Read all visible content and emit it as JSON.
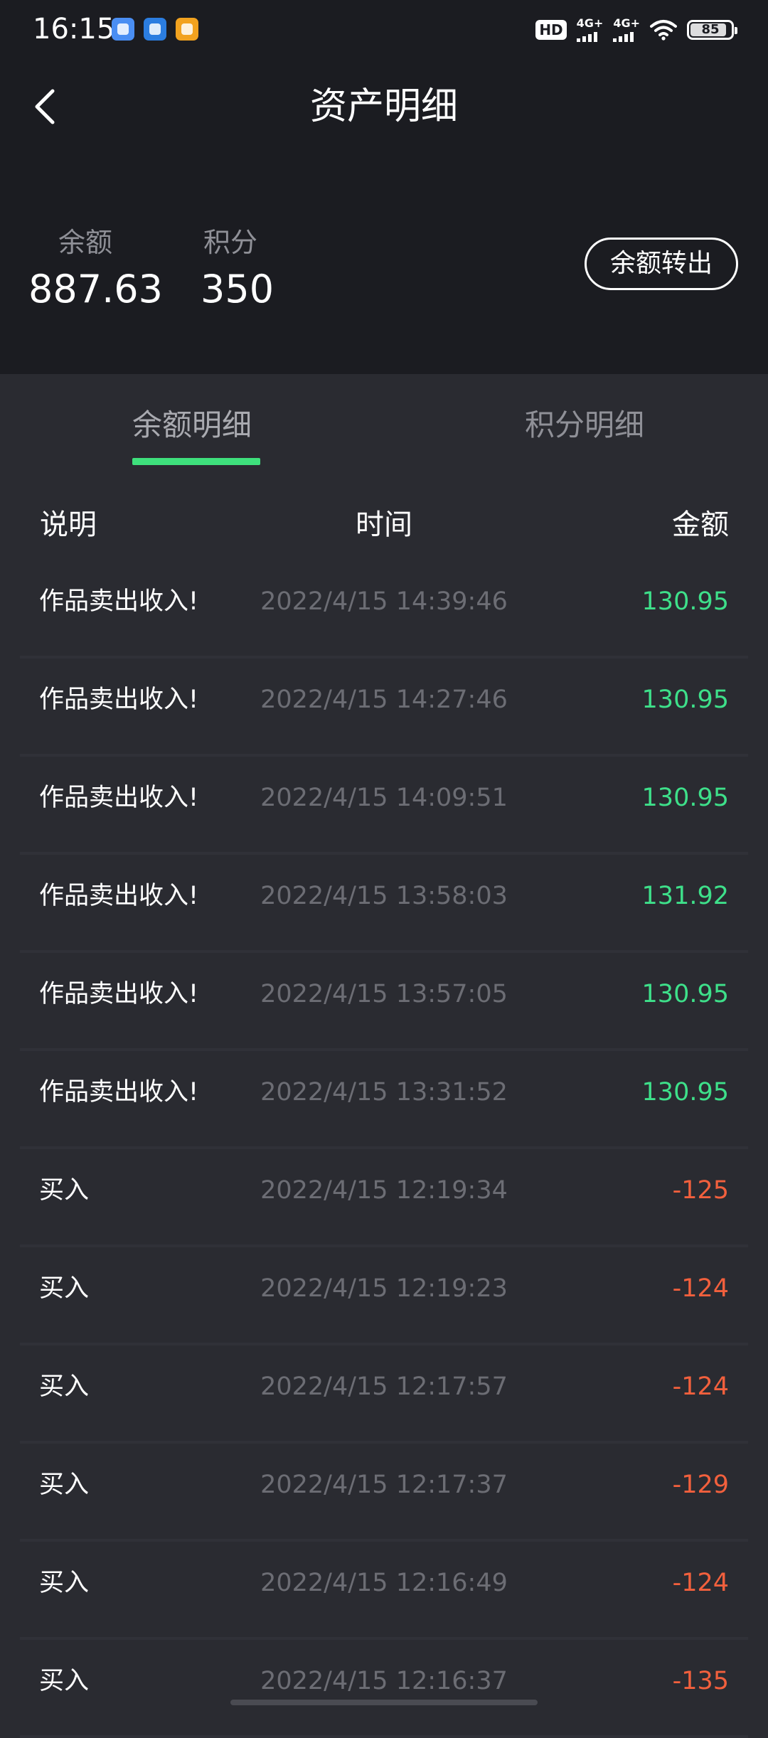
{
  "status_bar": {
    "time": "16:15",
    "hd_label": "HD",
    "network_1": "4G+",
    "network_2": "4G+",
    "battery": "85",
    "app_icons": [
      "baidu-icon",
      "tower-icon",
      "mail-icon"
    ]
  },
  "header": {
    "title": "资产明细",
    "back_icon": "chevron-left-icon"
  },
  "summary": {
    "balance_label": "余额",
    "balance_value": "887.63",
    "points_label": "积分",
    "points_value": "350",
    "transfer_button": "余额转出"
  },
  "tabs": [
    {
      "label": "余额明细",
      "active": true
    },
    {
      "label": "积分明细",
      "active": false
    }
  ],
  "table": {
    "columns": [
      "说明",
      "时间",
      "金额"
    ],
    "rows": [
      {
        "desc": "作品卖出收入!",
        "time": "2022/4/15 14:39:46",
        "amount": "130.95",
        "type": "income"
      },
      {
        "desc": "作品卖出收入!",
        "time": "2022/4/15 14:27:46",
        "amount": "130.95",
        "type": "income"
      },
      {
        "desc": "作品卖出收入!",
        "time": "2022/4/15 14:09:51",
        "amount": "130.95",
        "type": "income"
      },
      {
        "desc": "作品卖出收入!",
        "time": "2022/4/15 13:58:03",
        "amount": "131.92",
        "type": "income"
      },
      {
        "desc": "作品卖出收入!",
        "time": "2022/4/15 13:57:05",
        "amount": "130.95",
        "type": "income"
      },
      {
        "desc": "作品卖出收入!",
        "time": "2022/4/15 13:31:52",
        "amount": "130.95",
        "type": "income"
      },
      {
        "desc": "买入",
        "time": "2022/4/15 12:19:34",
        "amount": "-125",
        "type": "expense"
      },
      {
        "desc": "买入",
        "time": "2022/4/15 12:19:23",
        "amount": "-124",
        "type": "expense"
      },
      {
        "desc": "买入",
        "time": "2022/4/15 12:17:57",
        "amount": "-124",
        "type": "expense"
      },
      {
        "desc": "买入",
        "time": "2022/4/15 12:17:37",
        "amount": "-129",
        "type": "expense"
      },
      {
        "desc": "买入",
        "time": "2022/4/15 12:16:49",
        "amount": "-124",
        "type": "expense"
      },
      {
        "desc": "买入",
        "time": "2022/4/15 12:16:37",
        "amount": "-135",
        "type": "expense"
      }
    ]
  },
  "colors": {
    "accent_green": "#3ee07c",
    "income": "#3ee08a",
    "expense": "#f2603d",
    "header_bg": "#1b1c21",
    "body_bg": "#2a2b31"
  }
}
